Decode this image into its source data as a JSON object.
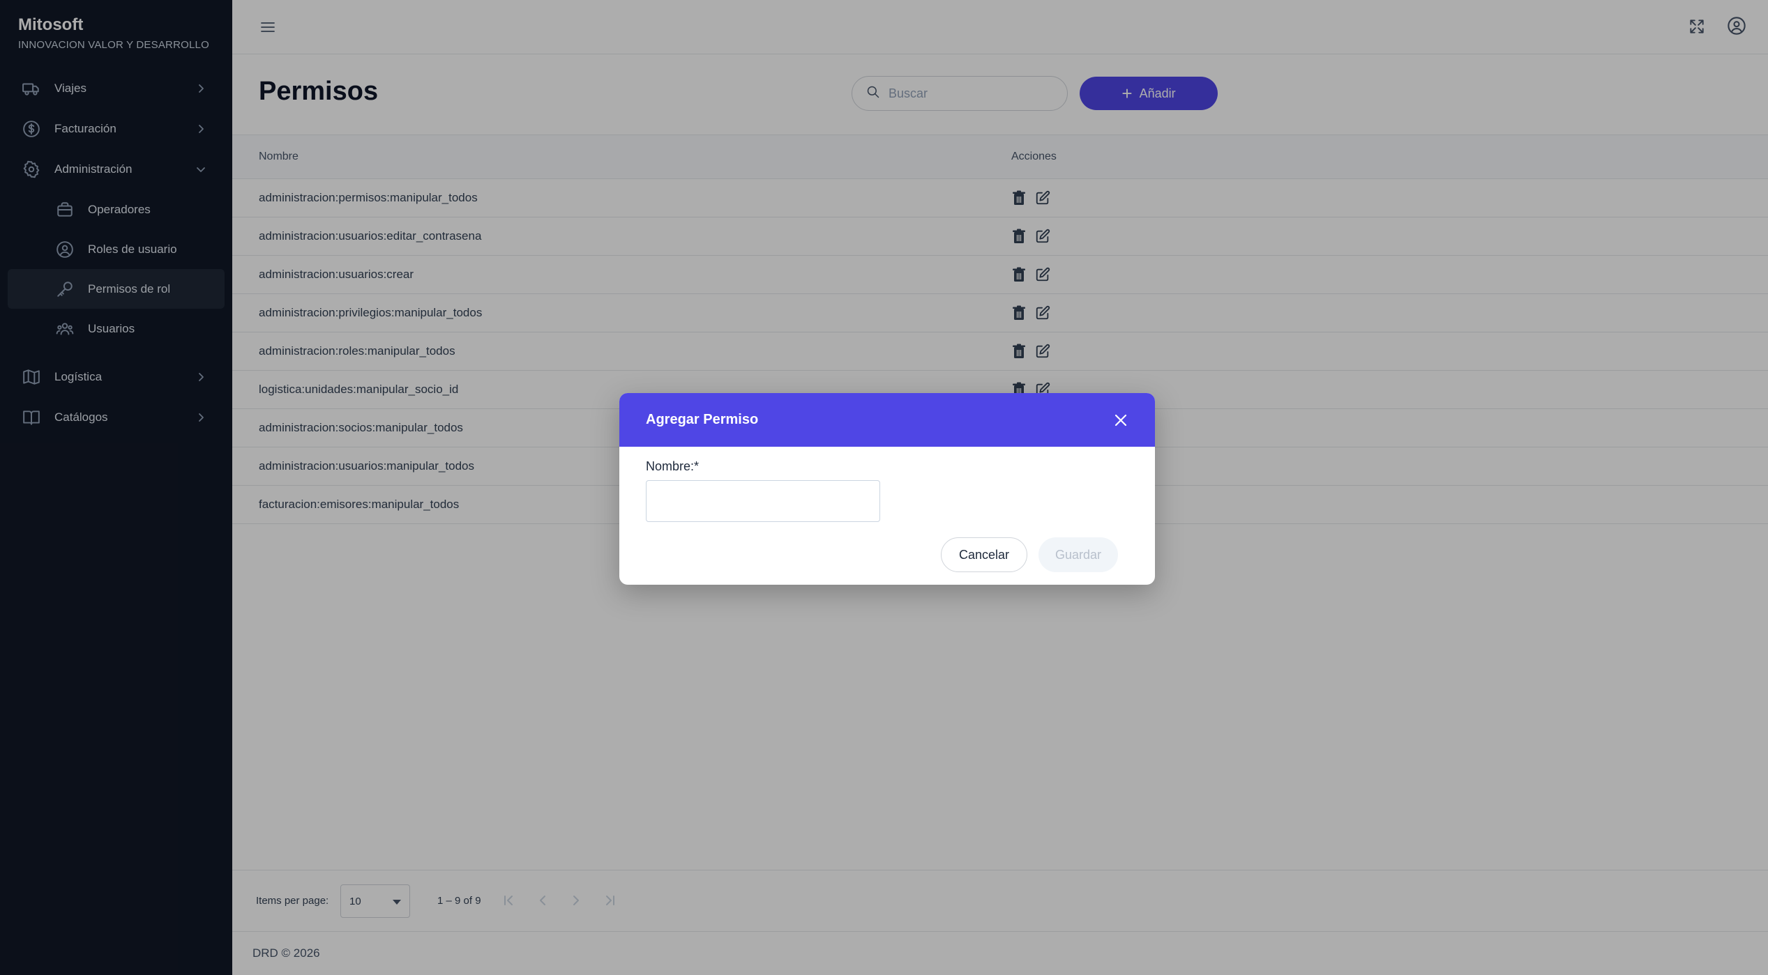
{
  "brand": {
    "title": "Mitosoft",
    "subtitle": "INNOVACION VALOR Y DESARROLLO"
  },
  "sidebar": {
    "items": [
      {
        "label": "Viajes",
        "icon": "truck-icon"
      },
      {
        "label": "Facturación",
        "icon": "dollar-icon"
      },
      {
        "label": "Administración",
        "icon": "gear-icon",
        "expanded": true,
        "children": [
          {
            "label": "Operadores",
            "icon": "briefcase-icon"
          },
          {
            "label": "Roles de usuario",
            "icon": "user-circle-icon"
          },
          {
            "label": "Permisos de rol",
            "icon": "key-icon",
            "active": true
          },
          {
            "label": "Usuarios",
            "icon": "users-icon"
          }
        ]
      },
      {
        "label": "Logística",
        "icon": "map-icon"
      },
      {
        "label": "Catálogos",
        "icon": "book-icon"
      }
    ]
  },
  "main": {
    "title": "Permisos",
    "search_placeholder": "Buscar",
    "add_label": "Añadir",
    "columns": {
      "name": "Nombre",
      "actions": "Acciones"
    },
    "rows": [
      "administracion:permisos:manipular_todos",
      "administracion:usuarios:editar_contrasena",
      "administracion:usuarios:crear",
      "administracion:privilegios:manipular_todos",
      "administracion:roles:manipular_todos",
      "logistica:unidades:manipular_socio_id",
      "administracion:socios:manipular_todos",
      "administracion:usuarios:manipular_todos",
      "facturacion:emisores:manipular_todos"
    ]
  },
  "paginator": {
    "items_per_page_label": "Items per page:",
    "page_size": "10",
    "range": "1 – 9 of 9"
  },
  "footer": {
    "text": "DRD © 2026"
  },
  "dialog": {
    "title": "Agregar Permiso",
    "field_label": "Nombre:*",
    "field_value": "",
    "cancel_label": "Cancelar",
    "save_label": "Guardar"
  },
  "colors": {
    "accent": "#4f46e5",
    "sidebar_bg": "#111827"
  }
}
